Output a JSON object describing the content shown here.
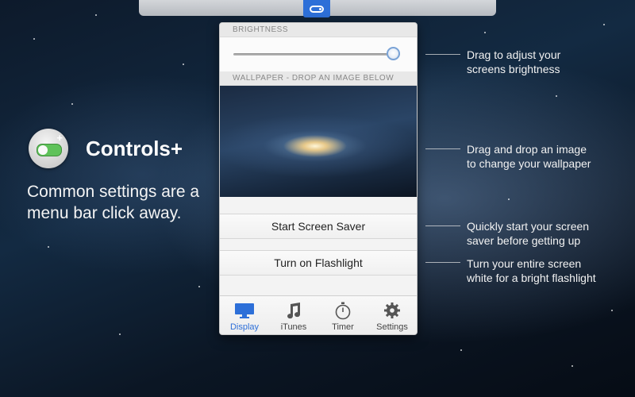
{
  "app": {
    "name": "Controls+",
    "tagline": "Common settings are a menu bar click away."
  },
  "panel": {
    "brightness_label": "BRIGHTNESS",
    "brightness_value": 0.96,
    "wallpaper_label": "WALLPAPER - DROP AN IMAGE BELOW",
    "buttons": {
      "screen_saver": "Start Screen Saver",
      "flashlight": "Turn on Flashlight"
    },
    "tabs": [
      {
        "label": "Display",
        "icon": "display-icon",
        "active": true
      },
      {
        "label": "iTunes",
        "icon": "music-note-icon",
        "active": false
      },
      {
        "label": "Timer",
        "icon": "stopwatch-icon",
        "active": false
      },
      {
        "label": "Settings",
        "icon": "gear-icon",
        "active": false
      }
    ]
  },
  "callouts": {
    "brightness": [
      "Drag to adjust your",
      "screens brightness"
    ],
    "wallpaper": [
      "Drag and drop an image",
      "to change your wallpaper"
    ],
    "screen_saver": [
      "Quickly start your screen",
      "saver before getting up"
    ],
    "flashlight": [
      "Turn your entire screen",
      "white for a bright flashlight"
    ]
  },
  "colors": {
    "accent": "#2d6fd8",
    "toggle_green": "#5fc25a"
  }
}
